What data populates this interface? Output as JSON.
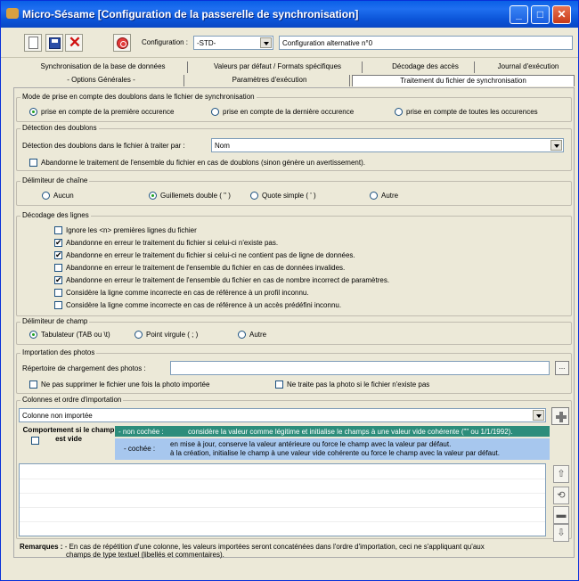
{
  "window": {
    "title": "Micro-Sésame [Configuration de la passerelle de synchronisation]",
    "minimize": "_",
    "maximize": "□",
    "close": "✕"
  },
  "toolbar": {
    "configuration_label": "Configuration :",
    "configuration_value": "-STD-",
    "configuration_alt": "Configuration alternative n°0"
  },
  "tabs": {
    "row1": [
      "Synchronisation de la base de données",
      "Valeurs par défaut / Formats spécifiques",
      "Décodage des accès",
      "Journal d'exécution"
    ],
    "row2": [
      "- Options Générales -",
      "Paramètres d'exécution",
      "Traitement du fichier de synchronisation"
    ],
    "active": "Traitement du fichier de synchronisation"
  },
  "doublons_mode": {
    "title": "Mode de prise en compte des doublons dans le fichier de synchronisation",
    "options": [
      "prise en compte de la première occurence",
      "prise en compte de la dernière occurence",
      "prise en compte de toutes les occurences"
    ],
    "selected": 0
  },
  "doublons_detection": {
    "title": "Détection des doublons",
    "field_label": "Détection des doublons dans le fichier à traiter par :",
    "field_value": "Nom",
    "abandon_label": "Abandonne le traitement de l'ensemble du fichier en cas de doublons (sinon génère un avertissement).",
    "abandon_checked": false
  },
  "delimiteur_chaine": {
    "title": "Délimiteur de chaîne",
    "options": [
      "Aucun",
      "Guillemets double ( \" )",
      "Quote simple ( ' )",
      "Autre"
    ],
    "selected": 1
  },
  "decodage_lignes": {
    "title": "Décodage des lignes",
    "items": [
      {
        "label": "Ignore les <n> premières lignes du fichier",
        "checked": false
      },
      {
        "label": "Abandonne en erreur le traitement du fichier si celui-ci n'existe pas.",
        "checked": true
      },
      {
        "label": "Abandonne en erreur le traitement du fichier si celui-ci ne contient pas de ligne de données.",
        "checked": true
      },
      {
        "label": "Abandonne en erreur le traitement de l'ensemble du fichier en cas de données invalides.",
        "checked": false
      },
      {
        "label": "Abandonne en erreur le traitement de l'ensemble du fichier en cas de nombre incorrect de paramètres.",
        "checked": true
      },
      {
        "label": "Considère la ligne comme incorrecte en cas de référence à un profil inconnu.",
        "checked": false
      },
      {
        "label": "Considère la ligne comme incorrecte en cas de référence à un accès prédéfini inconnu.",
        "checked": false
      }
    ]
  },
  "delimiteur_champ": {
    "title": "Délimiteur de champ",
    "options": [
      "Tabulateur (TAB ou \\t)",
      "Point virgule ( ; )",
      "Autre"
    ],
    "selected": 0
  },
  "photos": {
    "title": "Importation des photos",
    "dir_label": "Répertoire de chargement des photos :",
    "dir_value": "",
    "browse": "...",
    "no_delete_label": "Ne pas supprimer le fichier une fois la photo importée",
    "no_delete_checked": false,
    "skip_missing_label": "Ne traite pas la photo si le fichier n'existe pas",
    "skip_missing_checked": false
  },
  "colonnes": {
    "title": "Colonnes et ordre d'importation",
    "combo_value": "Colonne non importée",
    "behavior_title": "Comportement si le champ est vide",
    "unchecked_tag": "- non cochée :",
    "unchecked_text": "considère la valeur comme légitime et initialise le champs à une valeur vide cohérente (\"\" ou 1/1/1992).",
    "checked_tag": "- cochée :",
    "checked_text_1": "en mise à jour, conserve la valeur antérieure ou force le champ avec la valeur par défaut.",
    "checked_text_2": "à la création, initialise le champ à une valeur vide cohérente ou force le  champ avec la valeur par défaut."
  },
  "remarques": {
    "label": "Remarques :",
    "text_1": "- En cas de répétition d'une colonne,  les valeurs importées seront concaténées dans l'ordre d'importation, ceci ne s'appliquant qu'aux",
    "text_2": "champs de type textuel (libellés et commentaires)."
  }
}
